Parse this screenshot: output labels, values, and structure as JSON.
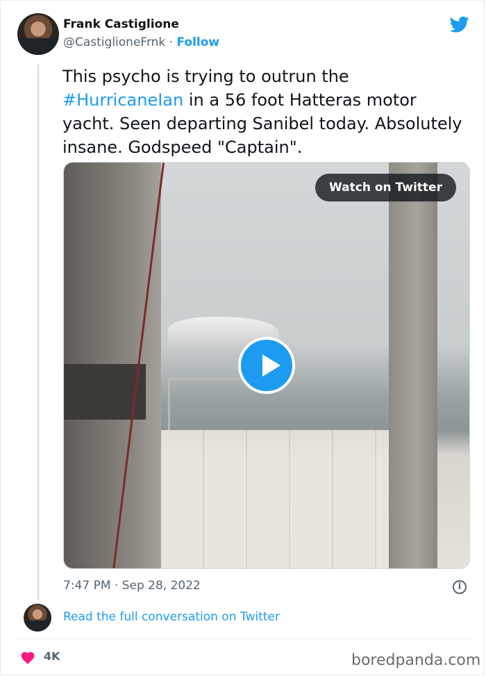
{
  "author": {
    "name": "Frank Castiglione",
    "handle": "@CastiglioneFrnk",
    "separator": "·",
    "follow_label": "Follow"
  },
  "tweet": {
    "text_before_hashtag": "This psycho is trying to outrun the ",
    "hashtag": "#HurricaneIan",
    "text_after_hashtag": " in a 56 foot Hatteras motor yacht. Seen departing Sanibel today. Absolutely insane. Godspeed \"Captain\"."
  },
  "media": {
    "watch_label": "Watch on Twitter",
    "play_icon": "play-icon"
  },
  "meta": {
    "timestamp": "7:47 PM · Sep 28, 2022",
    "info_icon": "i"
  },
  "conversation_link": "Read the full conversation on Twitter",
  "engagement": {
    "likes": "4K"
  },
  "watermark": "boredpanda.com",
  "colors": {
    "accent": "#1d9bf0",
    "heart": "#f91880",
    "text_secondary": "#536471"
  }
}
